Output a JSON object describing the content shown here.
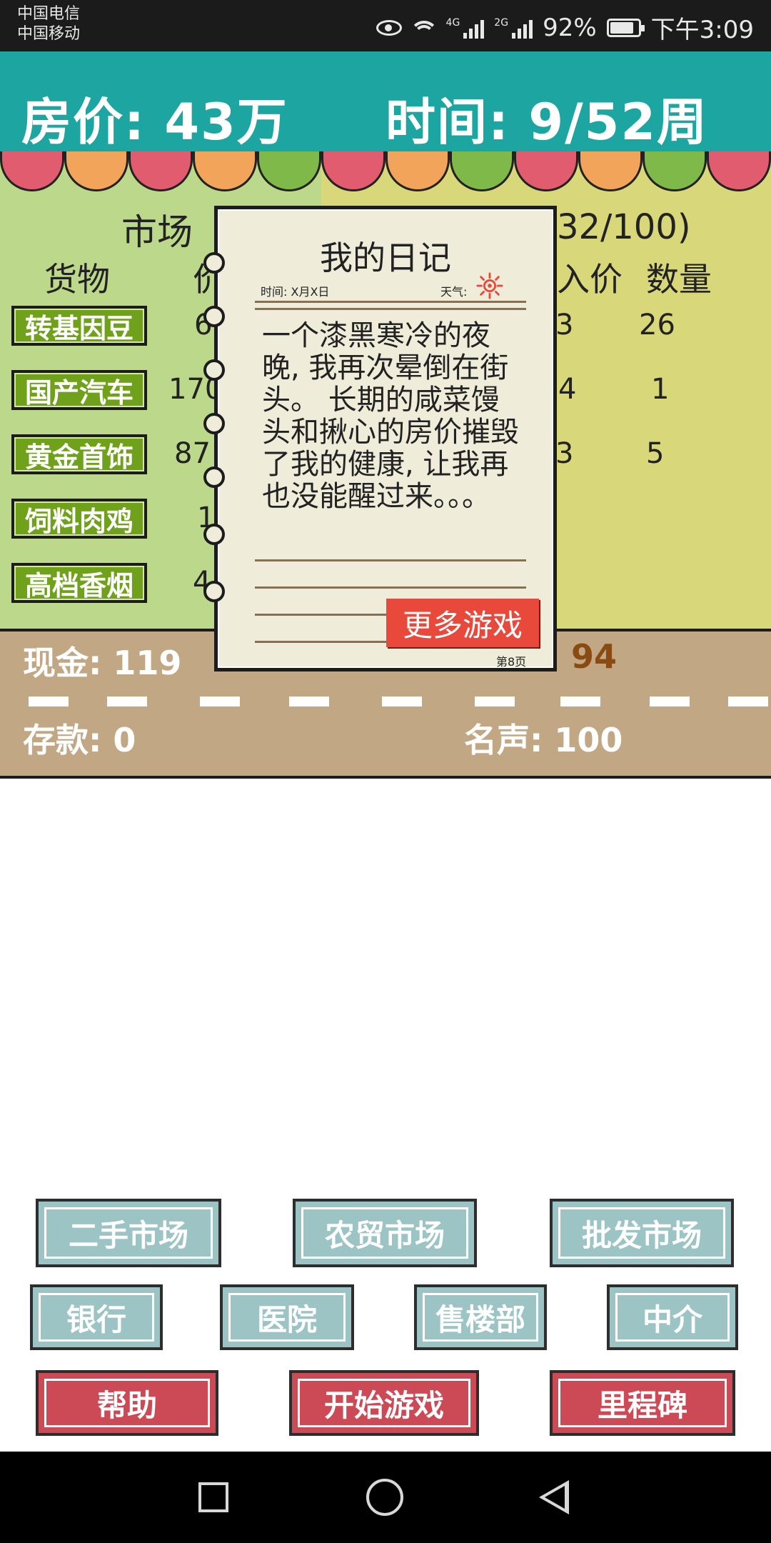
{
  "status_bar": {
    "carrier1": "中国电信",
    "carrier2": "中国移动",
    "net1": "4G",
    "net2": "2G",
    "battery": "92%",
    "time": "下午3:09"
  },
  "header": {
    "price_text": "房价: 43万",
    "time_text": "时间: 9/52周"
  },
  "market": {
    "title": "市场",
    "inventory_partial": "32/100)",
    "col_goods": "货物",
    "col_price_partial": "价",
    "col_buy_partial": "入价",
    "col_qty": "数量",
    "goods": [
      {
        "name": "转基因豆",
        "price_partial": "6"
      },
      {
        "name": "国产汽车",
        "price_partial": "170"
      },
      {
        "name": "黄金首饰",
        "price_partial": "87"
      },
      {
        "name": "饲料肉鸡",
        "price_partial": "1"
      },
      {
        "name": "高档香烟",
        "price_partial": "4"
      }
    ],
    "inventory_rows": [
      {
        "buy_partial": "3",
        "qty": "26"
      },
      {
        "buy_partial": "4",
        "qty": "1"
      },
      {
        "buy_partial": "3",
        "qty": "5"
      }
    ]
  },
  "ground": {
    "cash": "现金: 119",
    "partial_value": "94",
    "deposit": "存款: 0",
    "fame": "名声: 100"
  },
  "diary": {
    "title": "我的日记",
    "time_label": "时间: X月X日",
    "weather_label": "天气:",
    "body": "一个漆黑寒冷的夜晚, 我再次晕倒在街头。 长期的咸菜馒头和揪心的房价摧毁了我的健康, 让我再也没能醒过来。。。",
    "more_games": "更多游戏",
    "page": "第8页"
  },
  "buttons": {
    "second_hand": "二手市场",
    "farmers": "农贸市场",
    "wholesale": "批发市场",
    "bank": "银行",
    "hospital": "医院",
    "sales_office": "售楼部",
    "agency": "中介",
    "help": "帮助",
    "start": "开始游戏",
    "milestone": "里程碑"
  }
}
